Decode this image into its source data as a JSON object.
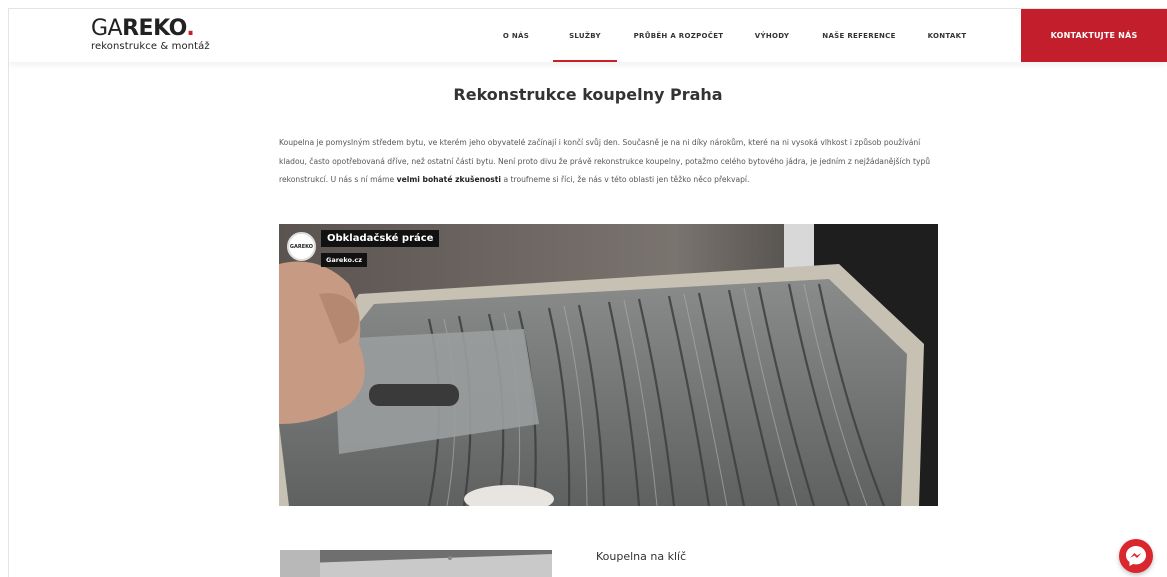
{
  "header": {
    "logo_prefix": "GA",
    "logo_bold": "REKO",
    "logo_dot": ".",
    "logo_sub": "rekonstrukce & montáž",
    "nav": [
      "O NÁS",
      "SLUŽBY",
      "PRŮBĚH A ROZPOČET",
      "VÝHODY",
      "NAŠE REFERENCE",
      "KONTAKT"
    ],
    "active_nav": "SLUŽBY",
    "cta": "KONTAKTUJTE NÁS"
  },
  "page": {
    "title": "Rekonstrukce koupelny Praha",
    "intro_part1": "Koupelna je pomyslným středem bytu, ve kterém jeho obyvatelé začínají i končí svůj den. Současně je na ni díky nárokům, které na ni vysoká vlhkost i způsob používání kladou, často opotřebovaná dříve, než ostatní části bytu. Není proto divu že právě rekonstrukce koupelny, potažmo celého bytového jádra, je jedním z nejžádanějších typů rekonstrukcí. U nás s ní máme ",
    "intro_bold": "velmi bohaté zkušenosti",
    "intro_part2": " a troufneme si říci, že nás v této oblasti jen těžko něco překvapí.",
    "subtitle": "Koupelna na klíč"
  },
  "video": {
    "badge": "GAREKO",
    "title": "Obkladačské práce",
    "channel": "Gareko.cz"
  },
  "colors": {
    "accent": "#c21e2b"
  },
  "icons": {
    "chat": "messenger-icon"
  }
}
